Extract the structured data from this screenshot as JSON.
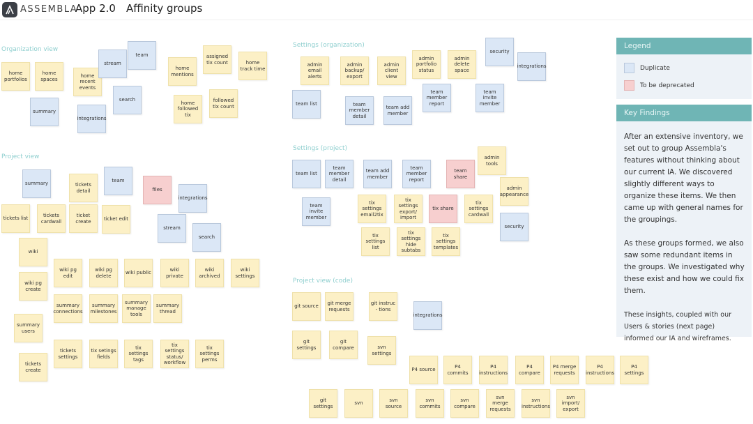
{
  "header": {
    "brand": "ASSEMBLA",
    "app_title": "App 2.0",
    "page_title": "Affinity groups",
    "logo_icon": "assembla-logo-icon"
  },
  "groups": [
    {
      "title": "Organization view"
    },
    {
      "title": "Project view"
    },
    {
      "title": "Settings (organization)"
    },
    {
      "title": "Settings (project)"
    },
    {
      "title": "Project view (code)"
    }
  ],
  "notes": [
    {
      "label": "home portfolios",
      "type": "feature",
      "group": "Organization view"
    },
    {
      "label": "home spaces",
      "type": "feature",
      "group": "Organization view"
    },
    {
      "label": "home recent events",
      "type": "feature",
      "group": "Organization view"
    },
    {
      "label": "stream",
      "type": "duplicate",
      "group": "Organization view"
    },
    {
      "label": "team",
      "type": "duplicate",
      "group": "Organization view"
    },
    {
      "label": "home mentions",
      "type": "feature",
      "group": "Organization view"
    },
    {
      "label": "assigned tix count",
      "type": "feature",
      "group": "Organization view"
    },
    {
      "label": "home track time",
      "type": "feature",
      "group": "Organization view"
    },
    {
      "label": "summary",
      "type": "duplicate",
      "group": "Organization view"
    },
    {
      "label": "integrations",
      "type": "duplicate",
      "group": "Organization view"
    },
    {
      "label": "search",
      "type": "duplicate",
      "group": "Organization view"
    },
    {
      "label": "home followed tix",
      "type": "feature",
      "group": "Organization view"
    },
    {
      "label": "followed tix count",
      "type": "feature",
      "group": "Organization view"
    },
    {
      "label": "summary",
      "type": "duplicate",
      "group": "Project view"
    },
    {
      "label": "tickets detail",
      "type": "feature",
      "group": "Project view"
    },
    {
      "label": "team",
      "type": "duplicate",
      "group": "Project view"
    },
    {
      "label": "files",
      "type": "deprecated",
      "group": "Project view"
    },
    {
      "label": "integrations",
      "type": "duplicate",
      "group": "Project view"
    },
    {
      "label": "tickets list",
      "type": "feature",
      "group": "Project view"
    },
    {
      "label": "tickets cardwall",
      "type": "feature",
      "group": "Project view"
    },
    {
      "label": "ticket create",
      "type": "feature",
      "group": "Project view"
    },
    {
      "label": "ticket edit",
      "type": "feature",
      "group": "Project view"
    },
    {
      "label": "stream",
      "type": "duplicate",
      "group": "Project view"
    },
    {
      "label": "search",
      "type": "duplicate",
      "group": "Project view"
    },
    {
      "label": "wiki",
      "type": "feature",
      "group": "Project view"
    },
    {
      "label": "wiki pg create",
      "type": "feature",
      "group": "Project view"
    },
    {
      "label": "wiki pg edit",
      "type": "feature",
      "group": "Project view"
    },
    {
      "label": "wiki pg delete",
      "type": "feature",
      "group": "Project view"
    },
    {
      "label": "wiki public",
      "type": "feature",
      "group": "Project view"
    },
    {
      "label": "wiki private",
      "type": "feature",
      "group": "Project view"
    },
    {
      "label": "wiki archived",
      "type": "feature",
      "group": "Project view"
    },
    {
      "label": "wiki settings",
      "type": "feature",
      "group": "Project view"
    },
    {
      "label": "summary connections",
      "type": "feature",
      "group": "Project view"
    },
    {
      "label": "summary milestones",
      "type": "feature",
      "group": "Project view"
    },
    {
      "label": "summary manage tools",
      "type": "feature",
      "group": "Project view"
    },
    {
      "label": "summary thread",
      "type": "feature",
      "group": "Project view"
    },
    {
      "label": "summary users",
      "type": "feature",
      "group": "Project view"
    },
    {
      "label": "tickets create",
      "type": "feature",
      "group": "Project view"
    },
    {
      "label": "tickets settings",
      "type": "feature",
      "group": "Project view"
    },
    {
      "label": "tix setings fields",
      "type": "feature",
      "group": "Project view"
    },
    {
      "label": "tix settings tags",
      "type": "feature",
      "group": "Project view"
    },
    {
      "label": "tix settings status/ workflow",
      "type": "feature",
      "group": "Project view"
    },
    {
      "label": "tix settings perms",
      "type": "feature",
      "group": "Project view"
    },
    {
      "label": "admin email alerts",
      "type": "feature",
      "group": "Settings (organization)"
    },
    {
      "label": "admin backup/ export",
      "type": "feature",
      "group": "Settings (organization)"
    },
    {
      "label": "admin client view",
      "type": "feature",
      "group": "Settings (organization)"
    },
    {
      "label": "admin portfolio status",
      "type": "feature",
      "group": "Settings (organization)"
    },
    {
      "label": "admin delete space",
      "type": "feature",
      "group": "Settings (organization)"
    },
    {
      "label": "security",
      "type": "duplicate",
      "group": "Settings (organization)"
    },
    {
      "label": "integrations",
      "type": "duplicate",
      "group": "Settings (organization)"
    },
    {
      "label": "team list",
      "type": "duplicate",
      "group": "Settings (organization)"
    },
    {
      "label": "team member detail",
      "type": "duplicate",
      "group": "Settings (organization)"
    },
    {
      "label": "team add member",
      "type": "duplicate",
      "group": "Settings (organization)"
    },
    {
      "label": "team member report",
      "type": "duplicate",
      "group": "Settings (organization)"
    },
    {
      "label": "team invite member",
      "type": "duplicate",
      "group": "Settings (organization)"
    },
    {
      "label": "team list",
      "type": "duplicate",
      "group": "Settings (project)"
    },
    {
      "label": "team member detail",
      "type": "duplicate",
      "group": "Settings (project)"
    },
    {
      "label": "team add member",
      "type": "duplicate",
      "group": "Settings (project)"
    },
    {
      "label": "team member report",
      "type": "duplicate",
      "group": "Settings (project)"
    },
    {
      "label": "team share",
      "type": "deprecated",
      "group": "Settings (project)"
    },
    {
      "label": "admin tools",
      "type": "feature",
      "group": "Settings (project)"
    },
    {
      "label": "admin appearance",
      "type": "feature",
      "group": "Settings (project)"
    },
    {
      "label": "team invite member",
      "type": "duplicate",
      "group": "Settings (project)"
    },
    {
      "label": "tix settings email2tix",
      "type": "feature",
      "group": "Settings (project)"
    },
    {
      "label": "tix settings export/ import",
      "type": "feature",
      "group": "Settings (project)"
    },
    {
      "label": "tix share",
      "type": "deprecated",
      "group": "Settings (project)"
    },
    {
      "label": "tix settings cardwall",
      "type": "feature",
      "group": "Settings (project)"
    },
    {
      "label": "security",
      "type": "duplicate",
      "group": "Settings (project)"
    },
    {
      "label": "tix settings list",
      "type": "feature",
      "group": "Settings (project)"
    },
    {
      "label": "tix settings hide subtabs",
      "type": "feature",
      "group": "Settings (project)"
    },
    {
      "label": "tix settings templates",
      "type": "feature",
      "group": "Settings (project)"
    },
    {
      "label": "git source",
      "type": "feature",
      "group": "Project view (code)"
    },
    {
      "label": "git merge requests",
      "type": "feature",
      "group": "Project view (code)"
    },
    {
      "label": "git instruc - tions",
      "type": "feature",
      "group": "Project view (code)"
    },
    {
      "label": "integrations",
      "type": "duplicate",
      "group": "Project view (code)"
    },
    {
      "label": "git settings",
      "type": "feature",
      "group": "Project view (code)"
    },
    {
      "label": "git compare",
      "type": "feature",
      "group": "Project view (code)"
    },
    {
      "label": "svn settings",
      "type": "feature",
      "group": "Project view (code)"
    },
    {
      "label": "P4 source",
      "type": "feature",
      "group": "Project view (code)"
    },
    {
      "label": "P4 commits",
      "type": "feature",
      "group": "Project view (code)"
    },
    {
      "label": "P4 instructions",
      "type": "feature",
      "group": "Project view (code)"
    },
    {
      "label": "P4 compare",
      "type": "feature",
      "group": "Project view (code)"
    },
    {
      "label": "P4 merge requests",
      "type": "feature",
      "group": "Project view (code)"
    },
    {
      "label": "P4 instructions",
      "type": "feature",
      "group": "Project view (code)"
    },
    {
      "label": "P4 settings",
      "type": "feature",
      "group": "Project view (code)"
    },
    {
      "label": "git settings",
      "type": "feature",
      "group": "Project view (code)"
    },
    {
      "label": "svn",
      "type": "feature",
      "group": "Project view (code)"
    },
    {
      "label": "svn source",
      "type": "feature",
      "group": "Project view (code)"
    },
    {
      "label": "svn commits",
      "type": "feature",
      "group": "Project view (code)"
    },
    {
      "label": "svn compare",
      "type": "feature",
      "group": "Project view (code)"
    },
    {
      "label": "svn merge requests",
      "type": "feature",
      "group": "Project view (code)"
    },
    {
      "label": "svn instructions",
      "type": "feature",
      "group": "Project view (code)"
    },
    {
      "label": "svn import/ export",
      "type": "feature",
      "group": "Project view (code)"
    }
  ],
  "colors": {
    "feature": "#fcf0c6",
    "duplicate": "#dbe7f6",
    "deprecated": "#f7cfcf",
    "accent": "#6fb5b5",
    "group_title": "#8fcfcf"
  },
  "legend": {
    "title": "Legend",
    "items": [
      {
        "label": "Duplicate",
        "type": "duplicate"
      },
      {
        "label": "To be deprecated",
        "type": "deprecated"
      }
    ]
  },
  "findings": {
    "title": "Key Findings",
    "paragraphs": [
      "After an extensive inventory, we set out to group Assembla's features without thinking about our current IA. We discovered slightly different ways to organize these items. We then came up with general names for the groupings.",
      "As these groups formed, we also saw some redundant items in the groups. We investigated why these exist and how we could fix them.",
      "These insights, coupled with our Users & stories  (next page) informed our IA and wireframes."
    ]
  }
}
